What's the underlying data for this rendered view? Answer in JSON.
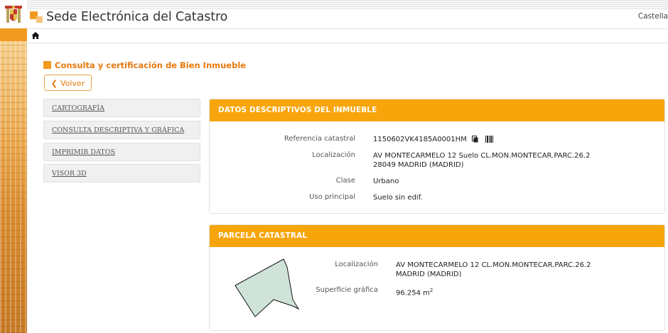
{
  "header": {
    "site_title": "Sede Electrónica del Catastro",
    "language_label": "Castella"
  },
  "page": {
    "heading": "Consulta y certificación de Bien Inmueble",
    "back_label": "Volver"
  },
  "menu": {
    "items": [
      {
        "label": "CARTOGRAFÍA"
      },
      {
        "label": "CONSULTA DESCRIPTIVA Y GRÁFICA"
      },
      {
        "label": "IMPRIMIR DATOS"
      },
      {
        "label": "VISOR 3D"
      }
    ]
  },
  "descriptive": {
    "title": "DATOS DESCRIPTIVOS DEL INMUEBLE",
    "ref_label": "Referencia catastral",
    "ref_value": "1150602VK4185A0001HM",
    "loc_label": "Localización",
    "loc_line1": "AV MONTECARMELO 12 Suelo CL.MON.MONTECAR.PARC.26.2",
    "loc_line2": "28049 MADRID (MADRID)",
    "class_label": "Clase",
    "class_value": "Urbano",
    "use_label": "Uso principal",
    "use_value": "Suelo sin edif."
  },
  "parcel": {
    "title": "PARCELA CATASTRAL",
    "loc_label": "Localización",
    "loc_line1": "AV MONTECARMELO 12 CL.MON.MONTECAR.PARC.26.2",
    "loc_line2": "MADRID (MADRID)",
    "area_label": "Superficie gráfica",
    "area_value": "96.254 m",
    "area_unit_sup": "2"
  },
  "colors": {
    "accent_orange": "#f7a50a",
    "heading_orange": "#e8790e",
    "parcel_fill": "#cfe3d9"
  },
  "icons": [
    "crest-icon",
    "home-icon",
    "copy-icon",
    "barcode-icon",
    "chevron-left-icon"
  ]
}
